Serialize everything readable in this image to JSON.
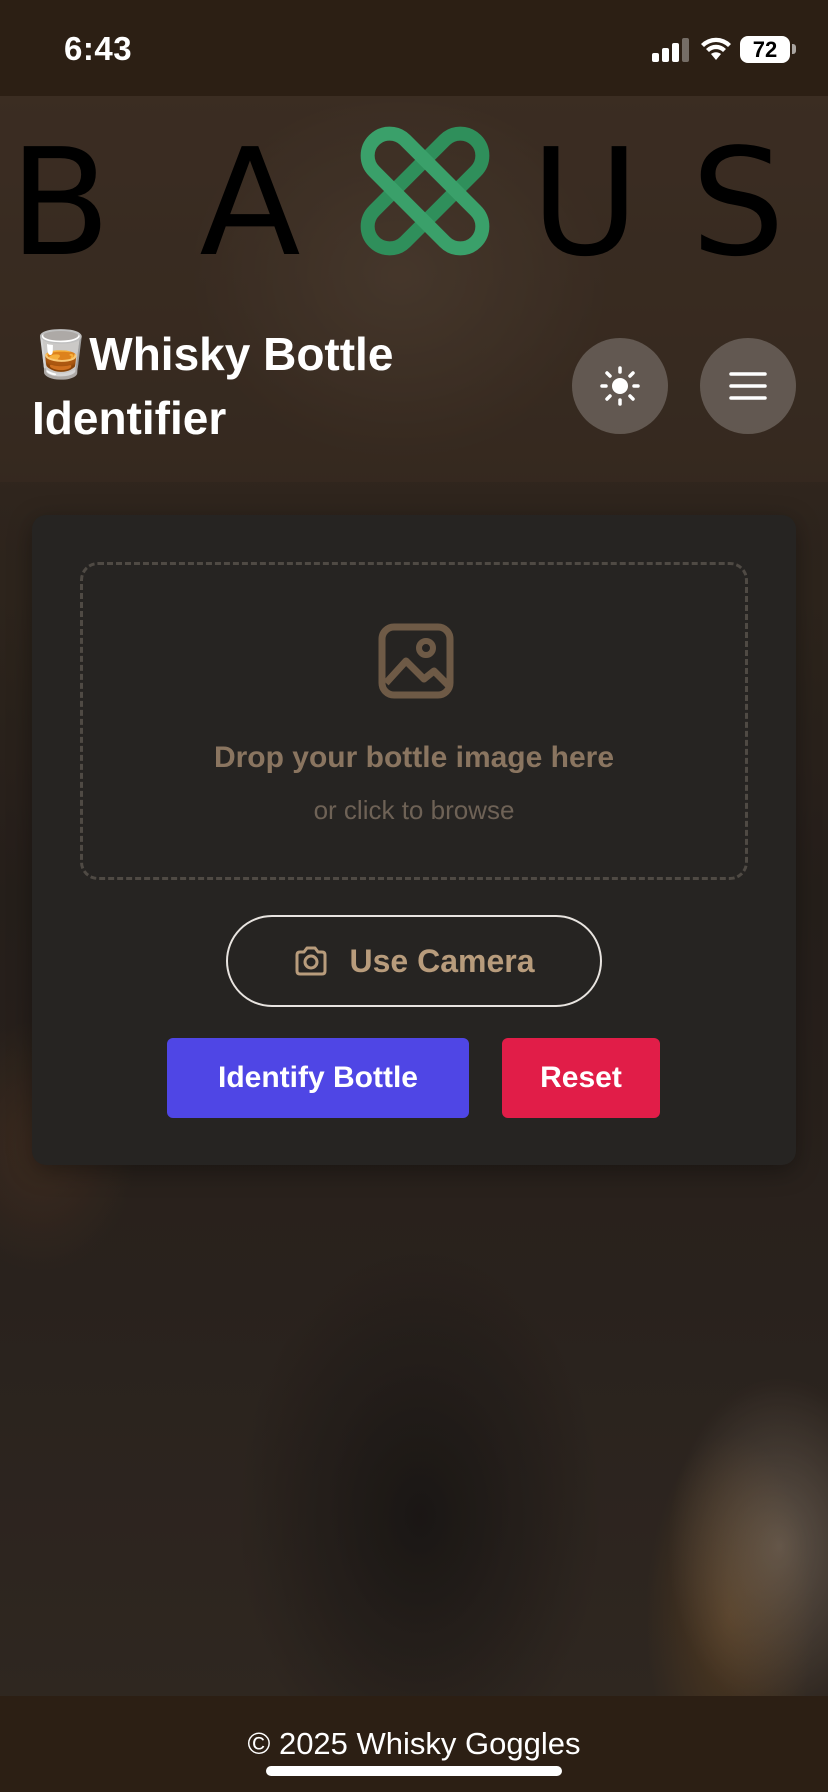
{
  "status_bar": {
    "time": "6:43",
    "battery_level": "72",
    "signal_bars": 3,
    "wifi": true
  },
  "header": {
    "logo": {
      "letters_left": [
        "B",
        "A"
      ],
      "letters_right": [
        "U",
        "S"
      ],
      "mark_icon": "interlocked-x-chain-icon",
      "mark_color": "#2f8f5b"
    },
    "title_emoji": "🥃",
    "title": "Whisky Bottle Identifier",
    "theme_toggle_icon": "sun-icon",
    "menu_icon": "hamburger-menu-icon"
  },
  "upload_card": {
    "dropzone_icon": "image-icon",
    "drop_title": "Drop your bottle image here",
    "drop_subtitle": "or click to browse",
    "camera_icon": "camera-icon",
    "camera_label": "Use Camera",
    "identify_label": "Identify Bottle",
    "reset_label": "Reset"
  },
  "colors": {
    "identify": "#4f46e5",
    "reset": "#e11d48",
    "chrome": "#2c1f14"
  },
  "footer": {
    "text": "© 2025 Whisky Goggles"
  }
}
